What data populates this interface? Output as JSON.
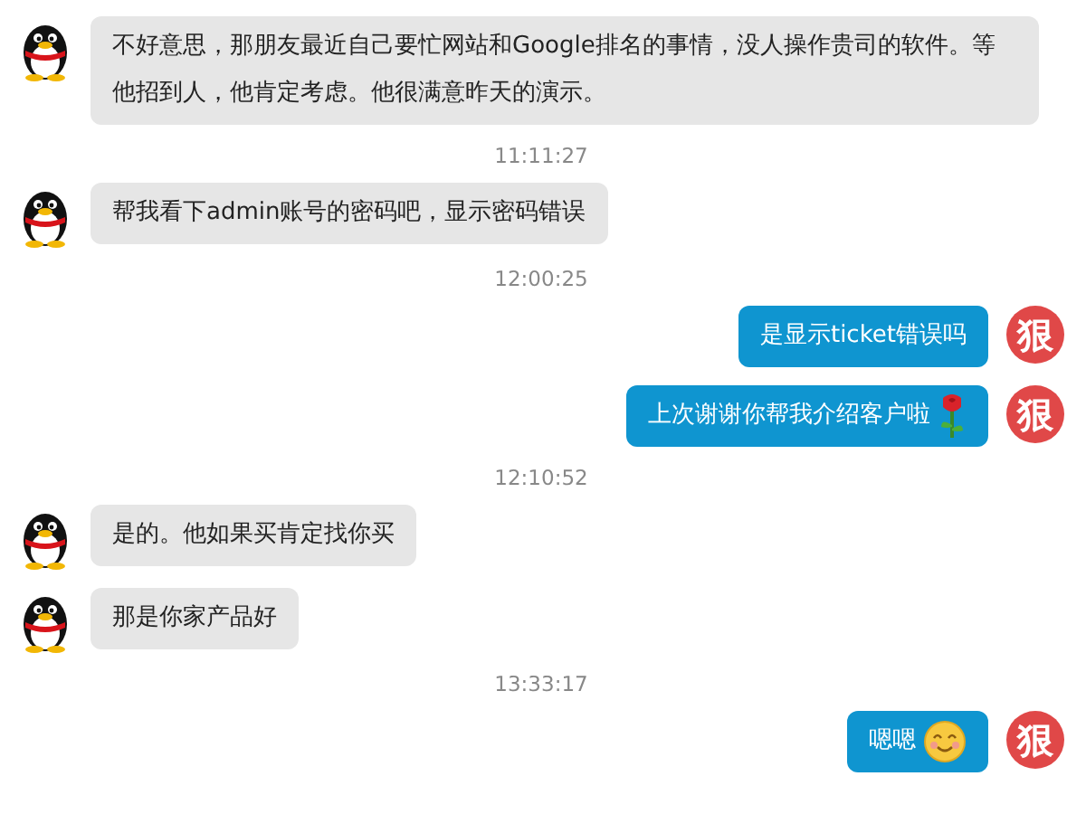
{
  "messages": [
    {
      "kind": "incoming",
      "parts": [
        {
          "kind": "text",
          "text": "不好意思，那朋友最近自己要忙网站和Google排名的事情，没人操作贵司的软件。等他招到人，他肯定考虑。他很满意昨天的演示。"
        }
      ]
    },
    {
      "kind": "time",
      "text": "11:11:27"
    },
    {
      "kind": "incoming",
      "parts": [
        {
          "kind": "text",
          "text": "帮我看下admin账号的密码吧，显示密码错误"
        }
      ]
    },
    {
      "kind": "time",
      "text": "12:00:25"
    },
    {
      "kind": "outgoing",
      "avatar_text": "狠",
      "parts": [
        {
          "kind": "text",
          "text": "是显示ticket错误吗"
        }
      ]
    },
    {
      "kind": "outgoing",
      "avatar_text": "狠",
      "parts": [
        {
          "kind": "text",
          "text": "上次谢谢你帮我介绍客户啦"
        },
        {
          "kind": "rose"
        }
      ]
    },
    {
      "kind": "time",
      "text": "12:10:52"
    },
    {
      "kind": "incoming",
      "parts": [
        {
          "kind": "text",
          "text": "是的。他如果买肯定找你买"
        }
      ]
    },
    {
      "kind": "incoming",
      "parts": [
        {
          "kind": "text",
          "text": "那是你家产品好"
        }
      ]
    },
    {
      "kind": "time",
      "text": "13:33:17"
    },
    {
      "kind": "outgoing",
      "avatar_text": "狠",
      "parts": [
        {
          "kind": "text",
          "text": "嗯嗯"
        },
        {
          "kind": "smile"
        }
      ]
    }
  ]
}
